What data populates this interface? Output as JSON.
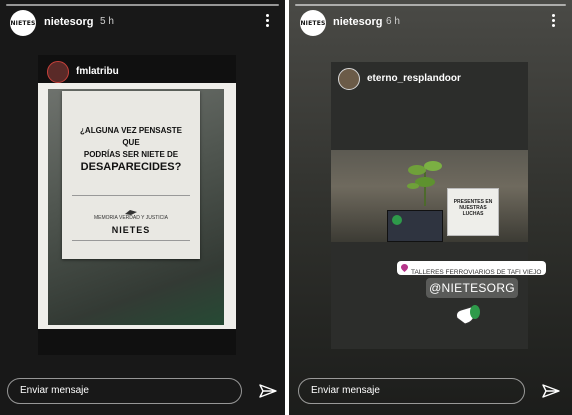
{
  "stories": [
    {
      "username": "nietesorg",
      "avatar_text": "NIETES",
      "time": "5 h",
      "reposted_username": "fmlatribu",
      "poster": {
        "question_line1": "¿ALGUNA VEZ PENSASTE QUE",
        "question_line2": "PODRÍAS SER NIETE DE",
        "question_line3": "DESAPARECIDES?",
        "org": "MEMORIA VERDAD Y JUSTICIA",
        "logo": "NIETES"
      },
      "message_placeholder": "Enviar mensaje"
    },
    {
      "username": "nietesorg",
      "avatar_text": "NIETES",
      "time": "6 h",
      "reposted_username": "eterno_resplandoor",
      "sign_text": "PRESENTES EN NUESTRAS LUCHAS",
      "location": "TALLERES FERROVIARIOS DE TAFI VIEJO",
      "mention": "@NIETESORG",
      "message_placeholder": "Enviar mensaje"
    }
  ],
  "colors": {
    "left_background": "#181818",
    "right_background": "#3c3d39",
    "text": "#ffffff",
    "location_pin": "#b5358a",
    "sticker": "#2e9a4a"
  }
}
